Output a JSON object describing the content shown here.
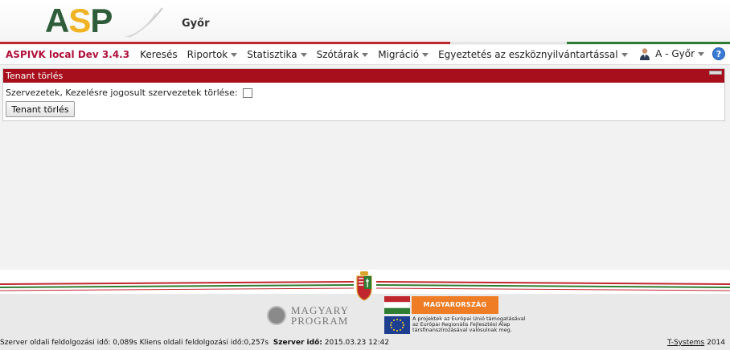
{
  "header": {
    "logo_a": "A",
    "logo_s": "S",
    "logo_p": "P",
    "city": "Győr"
  },
  "nav": {
    "brand": "ASPIVK local Dev 3.4.3",
    "items": [
      "Keresés",
      "Riportok",
      "Statisztika",
      "Szótárak",
      "Migráció",
      "Egyeztetés az eszköznyilvántartással"
    ],
    "user": "A - Győr",
    "help": "?"
  },
  "panel": {
    "title": "Tenant törlés",
    "checkbox_label": "Szervezetek, Kezelésre jogosult szervezetek törlése:",
    "button_label": "Tenant törlés"
  },
  "footer": {
    "magyary_line1": "MAGYARY",
    "magyary_line2": "PROGRAM",
    "banner": "MAGYARORSZÁG MEGÚJUL",
    "eu_line1": "A projektek az Európai Unió támogatásával",
    "eu_line2": "az Európai Regionális Fejlesztési Alap",
    "eu_line3": "társfinanszírozásával valósulnak meg.",
    "status_server": "Szerver oldali feldolgozási idő: 0,089s",
    "status_client": "Kliens oldali feldolgozási idő:0,257s",
    "status_time_label": "Szerver idő:",
    "status_time_value": "2015.03.23 12:42",
    "copyright_link": "T-Systems",
    "copyright_year": "2014"
  },
  "colors": {
    "accent_red": "#a70f1c",
    "brand": "#b0103a",
    "green": "#2e7d32",
    "orange": "#ef7d25"
  }
}
